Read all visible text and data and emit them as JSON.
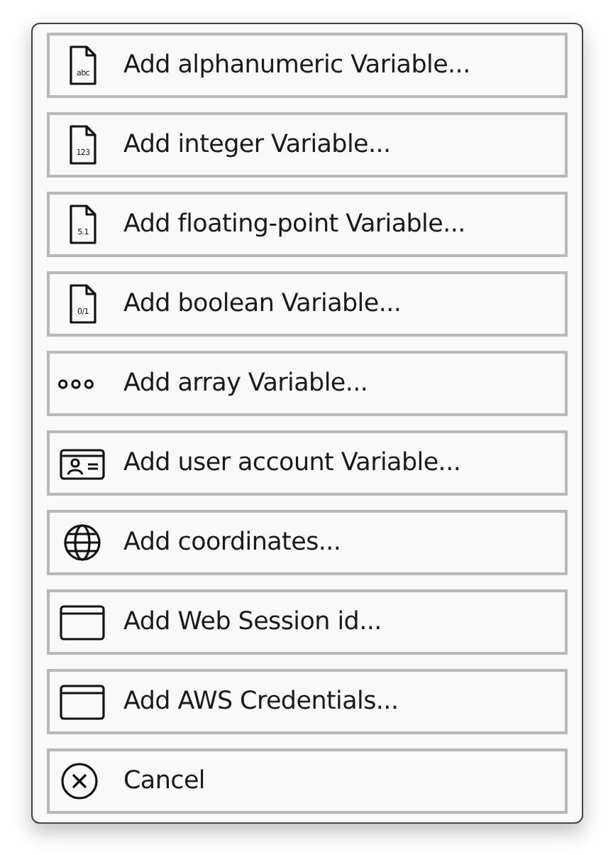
{
  "menu": {
    "items": [
      {
        "label": "Add alphanumeric Variable...",
        "kind": "file",
        "icon_label": "abc"
      },
      {
        "label": "Add integer Variable...",
        "kind": "file",
        "icon_label": "123"
      },
      {
        "label": "Add floating-point Variable...",
        "kind": "file",
        "icon_label": "5.1"
      },
      {
        "label": "Add boolean Variable...",
        "kind": "file",
        "icon_label": "0/1"
      },
      {
        "label": "Add array Variable...",
        "kind": "dots"
      },
      {
        "label": "Add user account Variable...",
        "kind": "card"
      },
      {
        "label": "Add coordinates...",
        "kind": "globe"
      },
      {
        "label": "Add Web Session id...",
        "kind": "window"
      },
      {
        "label": "Add AWS Credentials...",
        "kind": "window"
      },
      {
        "label": "Cancel",
        "kind": "cancel"
      }
    ]
  }
}
